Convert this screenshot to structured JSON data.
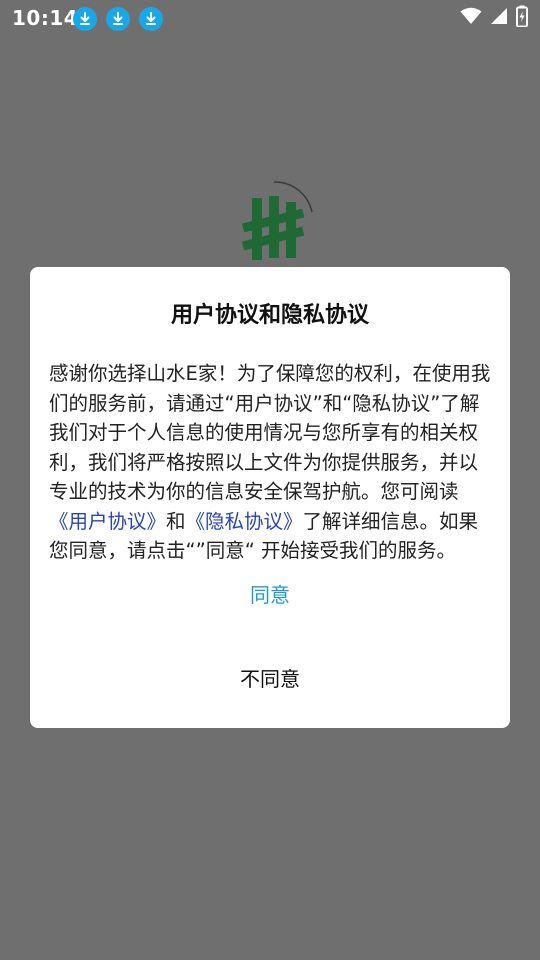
{
  "status_bar": {
    "time": "10:14",
    "download_icons": [
      "download-icon",
      "download-icon",
      "download-icon"
    ],
    "right_icons": [
      "wifi-icon",
      "cellular-signal-icon",
      "battery-charging-icon"
    ]
  },
  "app_logo": {
    "icon": "shanshui-logo-icon",
    "color": "#1f7a3a"
  },
  "dialog": {
    "title": "用户协议和隐私协议",
    "body": {
      "text_1": "感谢你选择山水E家！为了保障您的权利，在使用我们的服务前，请通过“用户协议”和“隐私协议”了解我们对于个人信息的使用情况与您所享有的相关权利，我们将严格按照以上文件为你提供服务，并以专业的技术为你的信息安全保驾护航。您可阅读",
      "link_user_agreement": "《用户协议》",
      "text_2": "和",
      "link_privacy_agreement": "《隐私协议》",
      "text_3": "了解详细信息。如果您同意，请点击“”同意“ 开始接受我们的服务。"
    },
    "agree_label": "同意",
    "disagree_label": "不同意"
  },
  "colors": {
    "overlay": "#6f6f6f",
    "dialog_bg": "#ffffff",
    "link": "#2a44b8",
    "agree": "#1e9ad6",
    "download_badge": "#1aa7e8"
  }
}
